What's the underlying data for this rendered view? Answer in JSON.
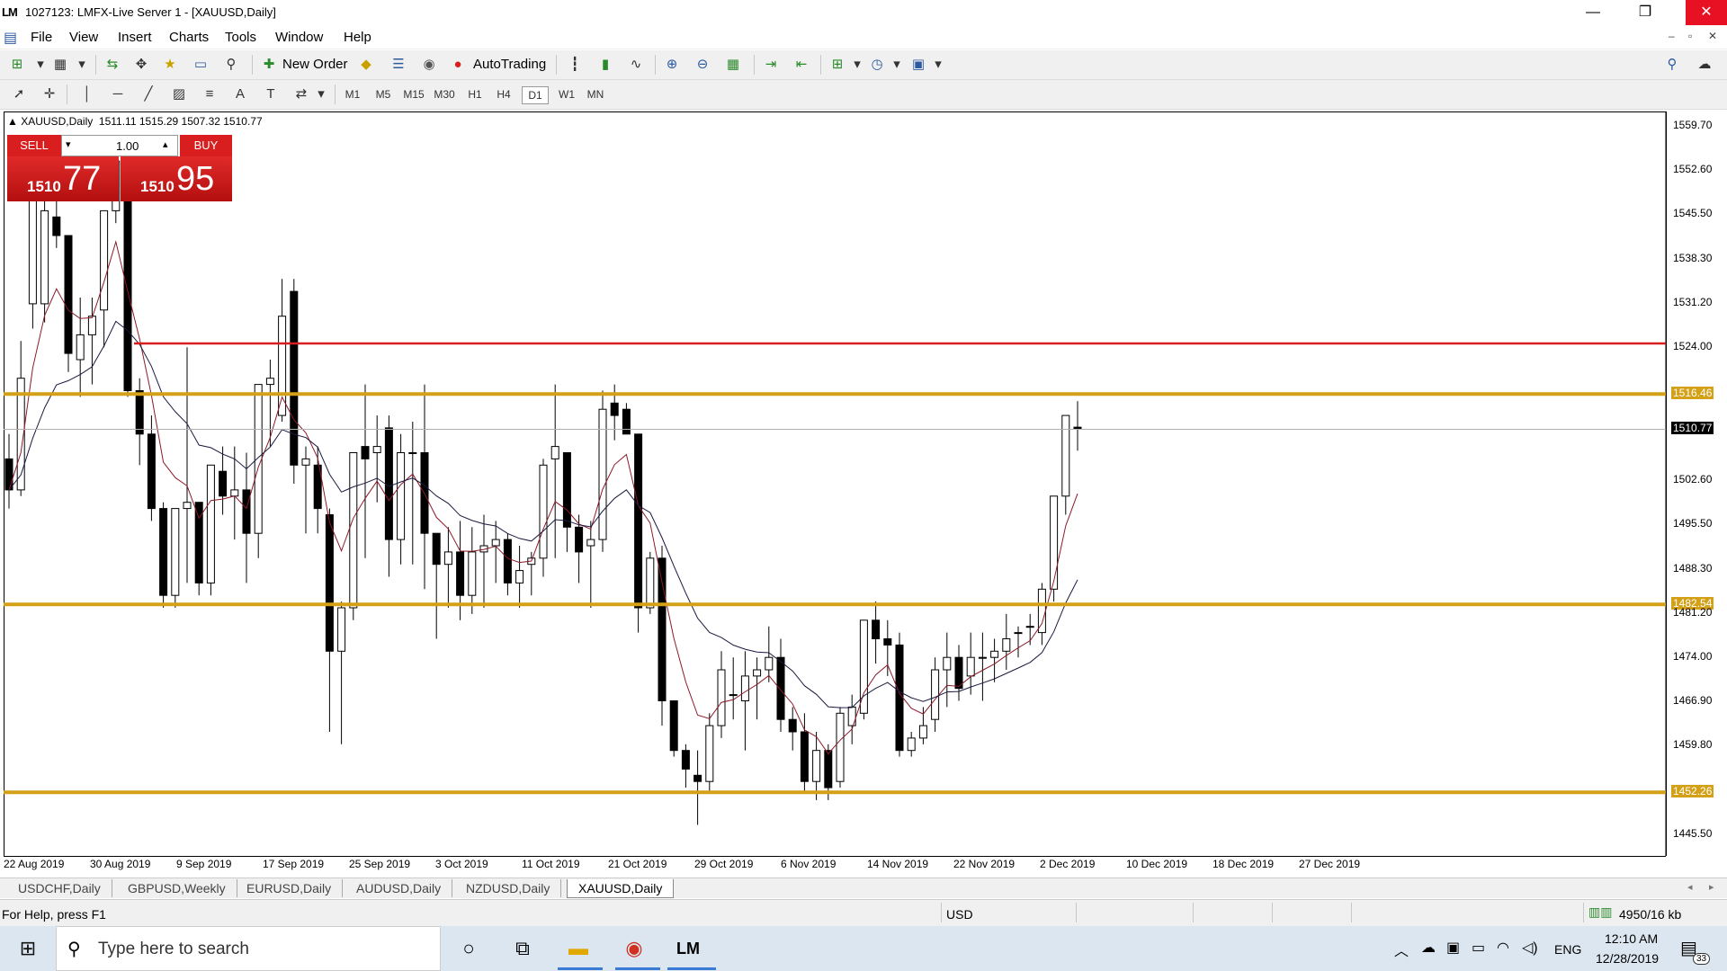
{
  "window": {
    "logo": "LM",
    "title": "1027123: LMFX-Live Server 1 - [XAUUSD,Daily]",
    "controls": [
      "—",
      "❐",
      "✕"
    ]
  },
  "menu": [
    "File",
    "View",
    "Insert",
    "Charts",
    "Tools",
    "Window",
    "Help"
  ],
  "toolbar": {
    "new_order": "New Order",
    "autotrading": "AutoTrading"
  },
  "timeframes": [
    "M1",
    "M5",
    "M15",
    "M30",
    "H1",
    "H4",
    "D1",
    "W1",
    "MN"
  ],
  "active_timeframe": "D1",
  "chart_header": {
    "symbol": "XAUUSD,Daily",
    "ohlc": "1511.11 1515.29 1507.32 1510.77"
  },
  "one_click": {
    "sell_label": "SELL",
    "buy_label": "BUY",
    "lot": "1.00",
    "sell_price_small": "1510",
    "sell_price_big": "77",
    "buy_price_small": "1510",
    "buy_price_big": "95"
  },
  "colors": {
    "bull": "#ffffff",
    "bear": "#000000",
    "ma_fast": "#8b1a2a",
    "ma_slow": "#1a1a40",
    "support_line": "#d4a017",
    "resistance_line": "#d81e1e",
    "sell_buy": "#d81e1e"
  },
  "chart_data": {
    "type": "candlestick",
    "title": "XAUUSD,Daily",
    "ylim": [
      1442,
      1562
    ],
    "y_ticks": [
      "1559.70",
      "1552.60",
      "1545.50",
      "1538.30",
      "1531.20",
      "1524.00",
      "1516.46",
      "1510.77",
      "1502.60",
      "1495.50",
      "1488.30",
      "1482.54",
      "1481.20",
      "1474.00",
      "1466.90",
      "1459.80",
      "1452.26",
      "1445.50"
    ],
    "x_tick_labels": [
      "22 Aug 2019",
      "30 Aug 2019",
      "9 Sep 2019",
      "17 Sep 2019",
      "25 Sep 2019",
      "3 Oct 2019",
      "11 Oct 2019",
      "21 Oct 2019",
      "29 Oct 2019",
      "6 Nov 2019",
      "14 Nov 2019",
      "22 Nov 2019",
      "2 Dec 2019",
      "10 Dec 2019",
      "18 Dec 2019",
      "27 Dec 2019"
    ],
    "horizontal_levels": [
      {
        "value": 1524.6,
        "color": "#d81e1e",
        "label": ""
      },
      {
        "value": 1516.46,
        "color": "#d4a017",
        "label": "1516.46"
      },
      {
        "value": 1482.54,
        "color": "#d4a017",
        "label": "1482.54"
      },
      {
        "value": 1452.26,
        "color": "#d4a017",
        "label": "1452.26"
      }
    ],
    "current_price": "1510.77",
    "candles": [
      [
        1506,
        1510,
        1498,
        1501
      ],
      [
        1501,
        1525,
        1500,
        1519
      ],
      [
        1531,
        1541,
        1527,
        1548
      ],
      [
        1531,
        1548,
        1528,
        1546
      ],
      [
        1545,
        1550,
        1540,
        1542
      ],
      [
        1542,
        1536,
        1520,
        1523
      ],
      [
        1522,
        1532,
        1516,
        1526
      ],
      [
        1526,
        1532,
        1518,
        1529
      ],
      [
        1530,
        1546,
        1524,
        1546
      ],
      [
        1546,
        1556,
        1544,
        1554
      ],
      [
        1553,
        1554,
        1516,
        1517
      ],
      [
        1517,
        1519,
        1505,
        1510
      ],
      [
        1510,
        1513,
        1496,
        1498
      ],
      [
        1498,
        1499,
        1482,
        1484
      ],
      [
        1484,
        1498,
        1482,
        1498
      ],
      [
        1498,
        1524,
        1486,
        1499
      ],
      [
        1499,
        1499,
        1484,
        1486
      ],
      [
        1486,
        1503,
        1484,
        1505
      ],
      [
        1504,
        1508,
        1497,
        1500
      ],
      [
        1500,
        1508,
        1493,
        1501
      ],
      [
        1501,
        1507,
        1486,
        1494
      ],
      [
        1494,
        1518,
        1490,
        1518
      ],
      [
        1518,
        1522,
        1508,
        1519
      ],
      [
        1513,
        1535,
        1512,
        1529
      ],
      [
        1533,
        1535,
        1502,
        1505
      ],
      [
        1505,
        1508,
        1494,
        1506
      ],
      [
        1505,
        1508,
        1494,
        1498
      ],
      [
        1497,
        1498,
        1462,
        1475
      ],
      [
        1475,
        1483,
        1460,
        1482
      ],
      [
        1482,
        1506,
        1480,
        1507
      ],
      [
        1508,
        1518,
        1490,
        1506
      ],
      [
        1507,
        1513,
        1499,
        1508
      ],
      [
        1511,
        1513,
        1487,
        1493
      ],
      [
        1493,
        1510,
        1489,
        1507
      ],
      [
        1507,
        1512,
        1489,
        1507
      ],
      [
        1507,
        1518,
        1485,
        1494
      ],
      [
        1494,
        1493,
        1477,
        1489
      ],
      [
        1489,
        1495,
        1482,
        1491
      ],
      [
        1491,
        1496,
        1480,
        1484
      ],
      [
        1484,
        1495,
        1481,
        1491
      ],
      [
        1491,
        1497,
        1482,
        1492
      ],
      [
        1492,
        1496,
        1486,
        1493
      ],
      [
        1493,
        1494,
        1484,
        1486
      ],
      [
        1486,
        1492,
        1482,
        1488
      ],
      [
        1489,
        1491,
        1484,
        1490
      ],
      [
        1490,
        1506,
        1487,
        1505
      ],
      [
        1506,
        1518,
        1490,
        1508
      ],
      [
        1507,
        1507,
        1491,
        1495
      ],
      [
        1495,
        1497,
        1486,
        1491
      ],
      [
        1492,
        1496,
        1482,
        1493
      ],
      [
        1493,
        1517,
        1491,
        1514
      ],
      [
        1515,
        1518,
        1509,
        1513
      ],
      [
        1514,
        1515,
        1510,
        1510
      ],
      [
        1510,
        1510,
        1478,
        1482
      ],
      [
        1482,
        1491,
        1481,
        1490
      ],
      [
        1490,
        1492,
        1463,
        1467
      ],
      [
        1467,
        1467,
        1458,
        1459
      ],
      [
        1459,
        1460,
        1453,
        1456
      ],
      [
        1455,
        1459,
        1447,
        1454
      ],
      [
        1454,
        1465,
        1452,
        1463
      ],
      [
        1463,
        1475,
        1461,
        1472
      ],
      [
        1468,
        1474,
        1464,
        1468
      ],
      [
        1467,
        1475,
        1459,
        1471
      ],
      [
        1471,
        1474,
        1464,
        1472
      ],
      [
        1472,
        1479,
        1470,
        1474
      ],
      [
        1474,
        1477,
        1462,
        1464
      ],
      [
        1464,
        1466,
        1459,
        1462
      ],
      [
        1462,
        1465,
        1452,
        1454
      ],
      [
        1454,
        1462,
        1451,
        1459
      ],
      [
        1459,
        1460,
        1451,
        1453
      ],
      [
        1454,
        1466,
        1453,
        1465
      ],
      [
        1463,
        1468,
        1460,
        1466
      ],
      [
        1465,
        1480,
        1464,
        1480
      ],
      [
        1480,
        1483,
        1473,
        1477
      ],
      [
        1477,
        1480,
        1471,
        1476
      ],
      [
        1476,
        1478,
        1458,
        1459
      ],
      [
        1459,
        1462,
        1458,
        1461
      ],
      [
        1461,
        1466,
        1460,
        1463
      ],
      [
        1464,
        1474,
        1462,
        1472
      ],
      [
        1472,
        1478,
        1466,
        1474
      ],
      [
        1474,
        1476,
        1467,
        1469
      ],
      [
        1471,
        1478,
        1468,
        1474
      ],
      [
        1474,
        1478,
        1467,
        1474
      ],
      [
        1474,
        1477,
        1470,
        1475
      ],
      [
        1475,
        1481,
        1472,
        1477
      ],
      [
        1478,
        1479,
        1474,
        1478
      ],
      [
        1479,
        1481,
        1476,
        1479
      ],
      [
        1478,
        1486,
        1476,
        1485
      ],
      [
        1485,
        1500,
        1483,
        1500
      ],
      [
        1500,
        1513,
        1497,
        1513
      ],
      [
        1511.11,
        1515.29,
        1507.32,
        1510.77
      ]
    ],
    "ma_fast_label": "",
    "ma_slow_label": ""
  },
  "tabs": [
    "USDCHF,Daily",
    "GBPUSD,Weekly",
    "EURUSD,Daily",
    "AUDUSD,Daily",
    "NZDUSD,Daily",
    "XAUUSD,Daily"
  ],
  "active_tab": "XAUUSD,Daily",
  "status": {
    "help": "For Help, press F1",
    "currency": "USD",
    "traffic": "4950/16 kb"
  },
  "taskbar": {
    "search_placeholder": "Type here to search",
    "lang": "ENG",
    "time": "12:10 AM",
    "date": "12/28/2019",
    "notifications": "33"
  }
}
